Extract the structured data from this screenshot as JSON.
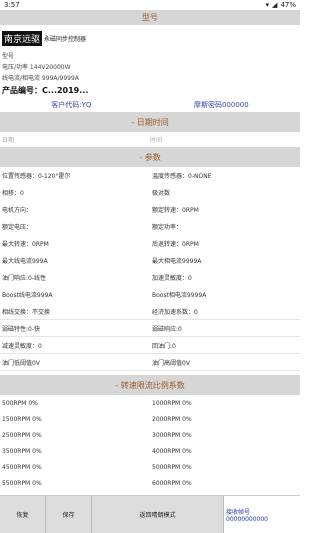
{
  "status": {
    "time": "3:57",
    "battery": "47%"
  },
  "model_header": "型号",
  "info": {
    "brand": "南京远驱",
    "brand_sub": "永磁同步控制器",
    "model_label": "型号",
    "voltage_power": "电压/功率  144V20000W",
    "current": "线电流/相电流  999A/9999A",
    "product_no": "产品编号：C...2019..."
  },
  "codes": {
    "customer": "客户代码:YQ",
    "morse": "摩斯密码000000"
  },
  "date_header": "- 日期时间",
  "date": {
    "date_label": "日期",
    "time_label": "时间"
  },
  "param_header": "- 参数",
  "params": [
    [
      "位置传感器：0-120°霍尔",
      "温度传感器：0-NONE"
    ],
    [
      "相移：0",
      "极对数"
    ],
    [
      "电机方向：",
      "额定转速：0RPM"
    ],
    [
      "额定电压：",
      "额定功率："
    ],
    [
      "最大转速：0RPM",
      "后退转速：0RPM"
    ],
    [
      "最大线电流999A",
      "最大相电流9999A"
    ],
    [
      "油门响应:0-线性",
      "加速灵敏度：0"
    ],
    [
      "Boost线电流999A",
      "Boost相电流9999A"
    ],
    [
      "相线交换：不交换",
      "经济加速系数：0"
    ],
    [
      "弱磁特性:0-快",
      "弱磁响应:0"
    ],
    [
      "减速灵敏度：0",
      "回油门:0"
    ],
    [
      "油门低阈值0V",
      "油门高阈值0V"
    ]
  ],
  "ratio_header": "- 转速限流比例系数",
  "ratios": [
    [
      "500RPM   0%",
      "1000RPM   0%"
    ],
    [
      "1500RPM   0%",
      "2000RPM   0%"
    ],
    [
      "2500RPM   0%",
      "3000RPM   0%"
    ],
    [
      "3500RPM   0%",
      "4000RPM   0%"
    ],
    [
      "4500RPM   0%",
      "5000RPM   0%"
    ],
    [
      "5500RPM   0%",
      "6000RPM   0%"
    ]
  ],
  "buttons": {
    "restore": "恢复",
    "save": "保存",
    "return": "返回晴朗模式"
  },
  "receive": {
    "label": "接收帧号",
    "value": "00000000000"
  }
}
